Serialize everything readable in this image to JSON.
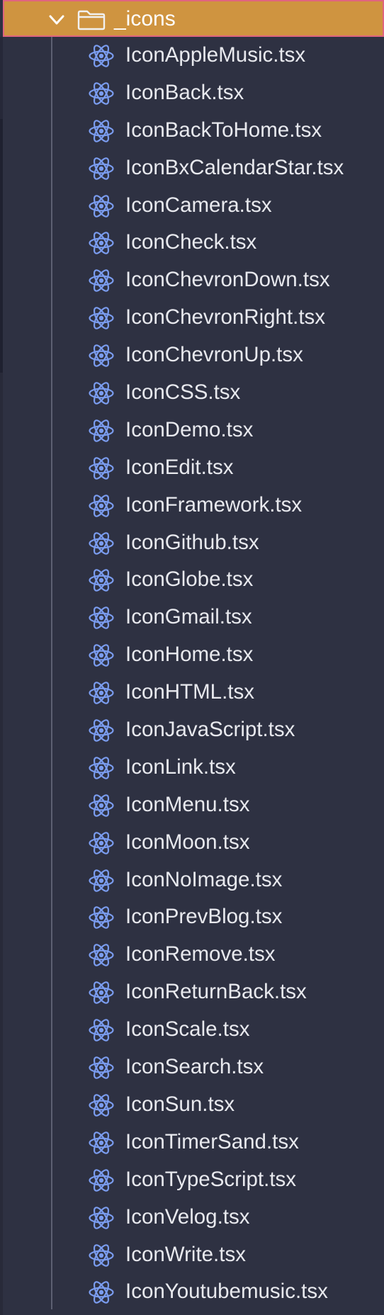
{
  "colors": {
    "panel_background": "#2e3142",
    "selected_row_background": "#cf9440",
    "selected_row_border": "#e0657f",
    "react_icon": "#7b9df0",
    "file_label": "#e8e9ee"
  },
  "folder": {
    "name": "_icons",
    "expanded": true,
    "chevron_icon": "chevron-down-icon",
    "folder_icon": "folder-outline-icon"
  },
  "files": [
    {
      "name": "IconAppleMusic.tsx",
      "icon": "react-icon"
    },
    {
      "name": "IconBack.tsx",
      "icon": "react-icon"
    },
    {
      "name": "IconBackToHome.tsx",
      "icon": "react-icon"
    },
    {
      "name": "IconBxCalendarStar.tsx",
      "icon": "react-icon"
    },
    {
      "name": "IconCamera.tsx",
      "icon": "react-icon"
    },
    {
      "name": "IconCheck.tsx",
      "icon": "react-icon"
    },
    {
      "name": "IconChevronDown.tsx",
      "icon": "react-icon"
    },
    {
      "name": "IconChevronRight.tsx",
      "icon": "react-icon"
    },
    {
      "name": "IconChevronUp.tsx",
      "icon": "react-icon"
    },
    {
      "name": "IconCSS.tsx",
      "icon": "react-icon"
    },
    {
      "name": "IconDemo.tsx",
      "icon": "react-icon"
    },
    {
      "name": "IconEdit.tsx",
      "icon": "react-icon"
    },
    {
      "name": "IconFramework.tsx",
      "icon": "react-icon"
    },
    {
      "name": "IconGithub.tsx",
      "icon": "react-icon"
    },
    {
      "name": "IconGlobe.tsx",
      "icon": "react-icon"
    },
    {
      "name": "IconGmail.tsx",
      "icon": "react-icon"
    },
    {
      "name": "IconHome.tsx",
      "icon": "react-icon"
    },
    {
      "name": "IconHTML.tsx",
      "icon": "react-icon"
    },
    {
      "name": "IconJavaScript.tsx",
      "icon": "react-icon"
    },
    {
      "name": "IconLink.tsx",
      "icon": "react-icon"
    },
    {
      "name": "IconMenu.tsx",
      "icon": "react-icon"
    },
    {
      "name": "IconMoon.tsx",
      "icon": "react-icon"
    },
    {
      "name": "IconNoImage.tsx",
      "icon": "react-icon"
    },
    {
      "name": "IconPrevBlog.tsx",
      "icon": "react-icon"
    },
    {
      "name": "IconRemove.tsx",
      "icon": "react-icon"
    },
    {
      "name": "IconReturnBack.tsx",
      "icon": "react-icon"
    },
    {
      "name": "IconScale.tsx",
      "icon": "react-icon"
    },
    {
      "name": "IconSearch.tsx",
      "icon": "react-icon"
    },
    {
      "name": "IconSun.tsx",
      "icon": "react-icon"
    },
    {
      "name": "IconTimerSand.tsx",
      "icon": "react-icon"
    },
    {
      "name": "IconTypeScript.tsx",
      "icon": "react-icon"
    },
    {
      "name": "IconVelog.tsx",
      "icon": "react-icon"
    },
    {
      "name": "IconWrite.tsx",
      "icon": "react-icon"
    },
    {
      "name": "IconYoutubemusic.tsx",
      "icon": "react-icon"
    }
  ]
}
